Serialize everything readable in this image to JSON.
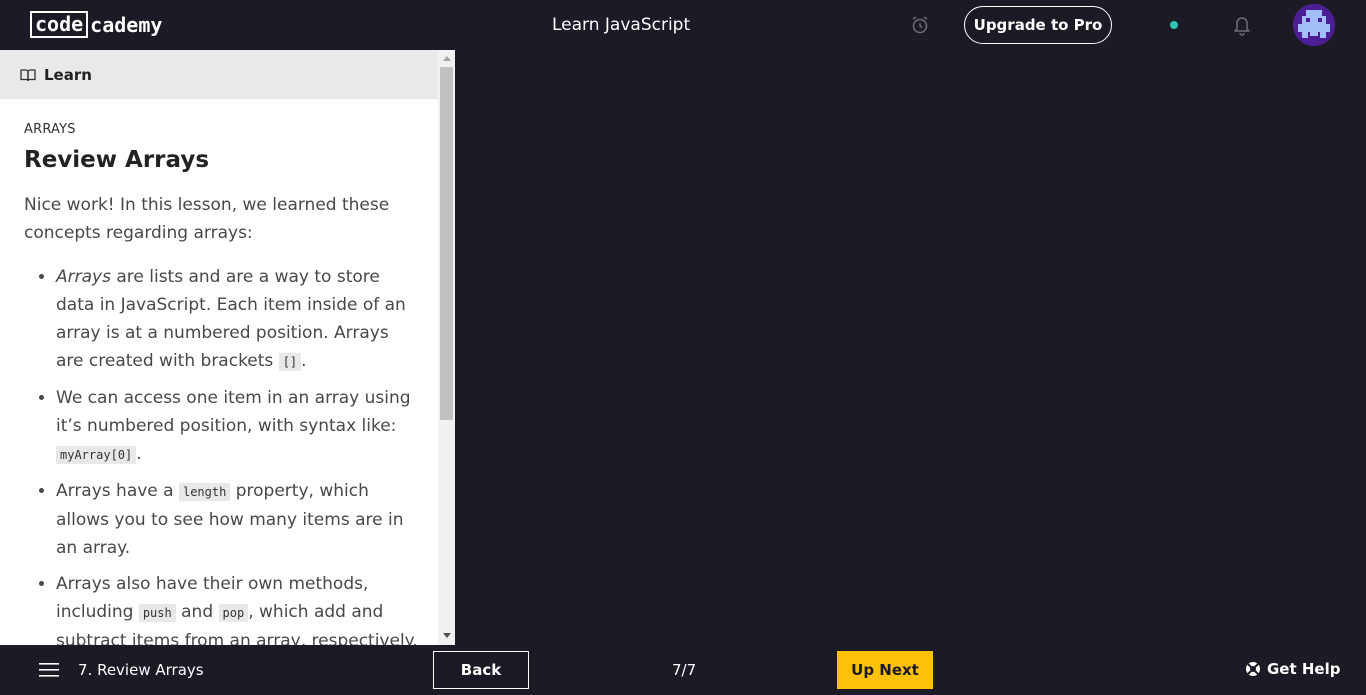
{
  "header": {
    "logo_part1": "code",
    "logo_part2": "cademy",
    "title": "Learn JavaScript",
    "upgrade_label": "Upgrade to Pro",
    "status_color": "#2ec4b6",
    "icons": [
      "alarm-icon",
      "bell-icon",
      "avatar"
    ]
  },
  "panel": {
    "tab_label": "Learn",
    "section": "ARRAYS",
    "title": "Review Arrays",
    "intro": "Nice work! In this lesson, we learned these concepts regarding arrays:",
    "bullets": [
      {
        "em": "Arrays",
        "text1": " are lists and are a way to store data in JavaScript. Each item inside of an array is at a numbered position. Arrays are created with brackets ",
        "code1": "[]",
        "text2": "."
      },
      {
        "text1": "We can access one item in an array using it’s numbered position, with syntax like: ",
        "code1": "myArray[0]",
        "text2": "."
      },
      {
        "text1": "Arrays have a ",
        "code1": "length",
        "text2": " property, which allows you to see how many items are in an array."
      },
      {
        "text1": "Arrays also have their own methods, including ",
        "code1": "push",
        "text2": " and ",
        "code2": "pop",
        "text3": ", which add and subtract items from an array, respectively."
      }
    ]
  },
  "footer": {
    "lesson_label": "7. Review Arrays",
    "back_label": "Back",
    "progress": "7/7",
    "next_label": "Up Next",
    "help_label": "Get Help",
    "next_color": "#ffc107"
  }
}
